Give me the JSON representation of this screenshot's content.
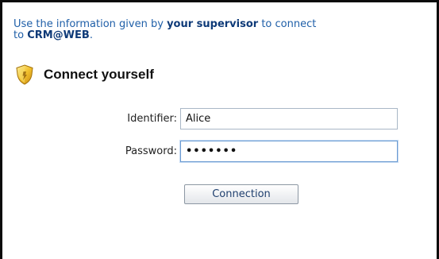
{
  "intro": {
    "line1_pre": "Use the information given by ",
    "line1_bold": "your supervisor",
    "line1_post": " to connect",
    "line2_pre": "to ",
    "line2_bold": "CRM@WEB",
    "line2_post": "."
  },
  "heading": {
    "icon": "shield-icon",
    "title": "Connect yourself"
  },
  "form": {
    "identifier_label": "Identifier:",
    "identifier_value": "Alice",
    "password_label": "Password:",
    "password_value": "xxxxxxx",
    "submit_label": "Connection"
  },
  "colors": {
    "link_text": "#1f5fa8",
    "bold_link": "#0e3a78",
    "input_focus_border": "#6b9bd2"
  }
}
